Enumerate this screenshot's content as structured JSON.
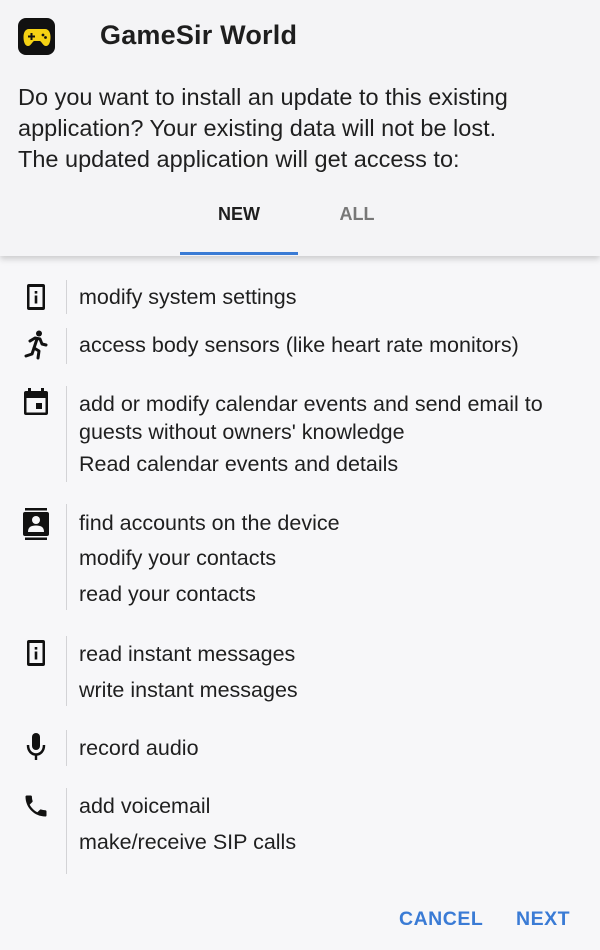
{
  "app": {
    "title": "GameSir World",
    "icon": "gamepad-app-icon",
    "icon_bg": "#111111",
    "icon_fg": "#f5d214"
  },
  "prompt": {
    "line1": "Do you want to install an update to this existing",
    "line2": "application? Your existing data will not be lost.",
    "line3": "The updated application will get access to:"
  },
  "tabs": [
    {
      "label": "NEW",
      "selected": true
    },
    {
      "label": "ALL",
      "selected": false
    }
  ],
  "permissions": [
    {
      "icon": "device-info-icon",
      "lines": [
        "modify system settings"
      ]
    },
    {
      "icon": "running-person-icon",
      "lines": [
        "access body sensors (like heart rate monitors)"
      ]
    },
    {
      "icon": "calendar-icon",
      "lines": [
        "add or modify calendar events and send email to",
        "guests without owners' knowledge",
        "Read calendar events and details"
      ]
    },
    {
      "icon": "contacts-icon",
      "lines": [
        "find accounts on the device",
        "modify your contacts",
        "read your contacts"
      ]
    },
    {
      "icon": "device-info-icon",
      "lines": [
        "read instant messages",
        "write instant messages"
      ]
    },
    {
      "icon": "microphone-icon",
      "lines": [
        "record audio"
      ]
    },
    {
      "icon": "phone-icon",
      "lines": [
        "add voicemail",
        "make/receive SIP calls"
      ]
    }
  ],
  "actions": {
    "cancel_label": "CANCEL",
    "next_label": "NEXT"
  },
  "colors": {
    "accent": "#3a7bd5",
    "header_bg": "#f4f4f6",
    "body_bg": "#f7f7f9"
  }
}
